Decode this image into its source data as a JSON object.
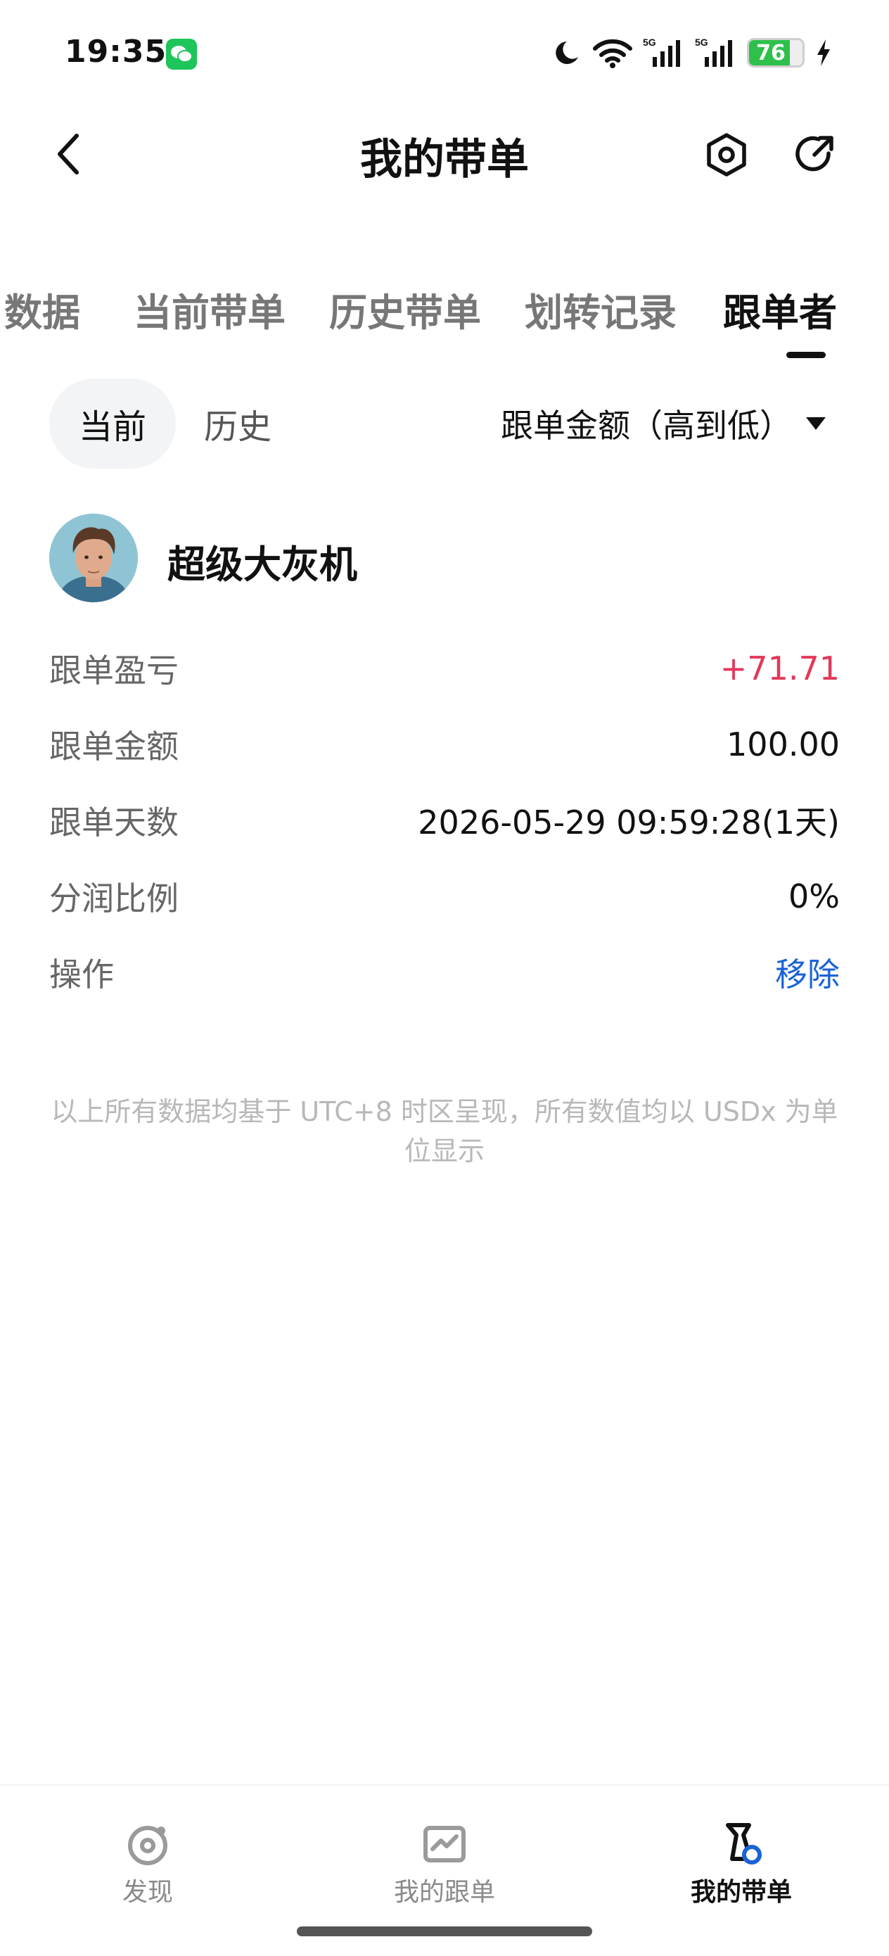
{
  "status_bar": {
    "time": "19:35",
    "battery": "76",
    "battery_level": 0.76,
    "icons": [
      "wechat-icon",
      "moon-icon",
      "wifi-icon",
      "signal-5g-icon",
      "signal-5g-icon",
      "battery-icon",
      "charging-icon"
    ]
  },
  "header": {
    "title": "我的带单"
  },
  "tabs": [
    {
      "label": "数据"
    },
    {
      "label": "当前带单"
    },
    {
      "label": "历史带单"
    },
    {
      "label": "划转记录"
    },
    {
      "label": "跟单者"
    }
  ],
  "subtabs": {
    "current": "当前",
    "history": "历史",
    "sort": "跟单金额（高到低）"
  },
  "follower": {
    "name": "超级大灰机",
    "rows": [
      {
        "label": "跟单盈亏",
        "value": "+71.71"
      },
      {
        "label": "跟单金额",
        "value": "100.00"
      },
      {
        "label": "跟单天数",
        "value": "2026-05-29 09:59:28(1天)"
      },
      {
        "label": "分润比例",
        "value": "0%"
      },
      {
        "label": "操作",
        "value": "移除"
      }
    ]
  },
  "footnote": "以上所有数据均基于 UTC+8 时区呈现，所有数值均以 USDx 为单位显示",
  "bottom_nav": [
    {
      "label": "发现",
      "icon": "discover-icon"
    },
    {
      "label": "我的跟单",
      "icon": "chart-icon"
    },
    {
      "label": "我的带单",
      "icon": "lead-trader-icon"
    }
  ],
  "colors": {
    "profit": "#e2385a",
    "link": "#1a63d6",
    "wechat": "#1ec55a",
    "battery": "#2ec04a"
  }
}
